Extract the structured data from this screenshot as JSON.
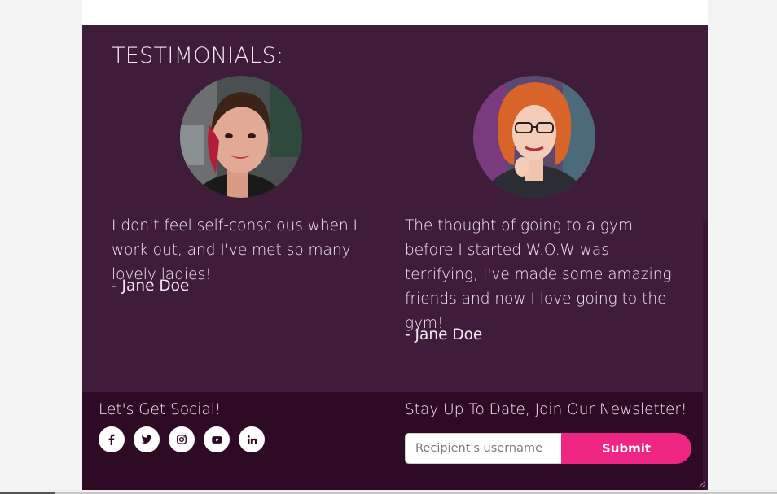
{
  "testimonials": {
    "title": "TESTIMONIALS:",
    "items": [
      {
        "quote": "I don't feel self-conscious when I work out, and I've met so many lovely ladies!",
        "author": "- Jane Doe"
      },
      {
        "quote": "The thought of going to a gym before I started W.O.W was terrifying, I've made some amazing friends and now I love going to the gym!",
        "author": "- Jane Doe"
      }
    ]
  },
  "footer": {
    "social_title": "Let's Get Social!",
    "social_icons": [
      "facebook-icon",
      "twitter-icon",
      "instagram-icon",
      "youtube-icon",
      "linkedin-icon"
    ],
    "newsletter_title": "Stay Up To Date, Join Our Newsletter!",
    "newsletter_placeholder": "Recipient's username",
    "submit_label": "Submit"
  },
  "colors": {
    "testimonials_bg": "#3f1c3a",
    "footer_bg": "#2e0a25",
    "accent": "#ef2583",
    "text": "#f4e9f1"
  }
}
